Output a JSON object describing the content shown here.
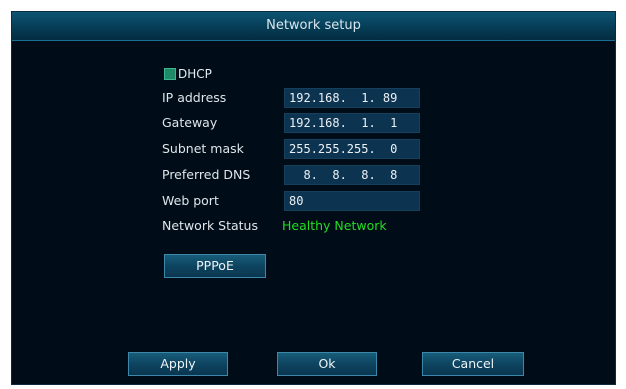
{
  "window": {
    "title": "Network setup"
  },
  "dhcp": {
    "label": "DHCP",
    "checked": true
  },
  "fields": [
    {
      "label": "IP address",
      "value": "192.168.  1. 89"
    },
    {
      "label": "Gateway",
      "value": "192.168.  1.  1"
    },
    {
      "label": "Subnet mask",
      "value": "255.255.255.  0"
    },
    {
      "label": "Preferred DNS",
      "value": "  8.  8.  8.  8"
    },
    {
      "label": "Web port",
      "value": "80"
    }
  ],
  "network_status": {
    "label": "Network Status",
    "value": "Healthy Network",
    "color": "#22dd22"
  },
  "buttons": {
    "pppoe": "PPPoE",
    "apply": "Apply",
    "ok": "Ok",
    "cancel": "Cancel"
  },
  "colors": {
    "background": "#000d18",
    "titlebar": "#0a4a66",
    "input": "#0c3350",
    "status_ok": "#22dd22"
  }
}
